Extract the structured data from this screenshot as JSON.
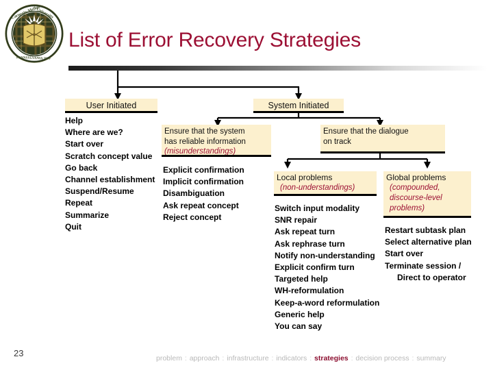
{
  "slide": {
    "title": "List of Error Recovery Strategies",
    "page_number": "23",
    "logo_alt": "carnegie-mellon-university-seal",
    "title_color": "#9C1034",
    "box_fill": "#FCF0CE",
    "accent_color": "#9C1034"
  },
  "diagram": {
    "root_branches": [
      {
        "id": "user-initiated",
        "label": "User Initiated"
      },
      {
        "id": "system-initiated",
        "label": "System Initiated"
      }
    ],
    "user_initiated": {
      "header": "User Initiated",
      "strategies": [
        "Help",
        "Where are we?",
        "Start over",
        "Scratch concept value",
        "Go back",
        "Channel establishment",
        "Suspend/Resume",
        "Repeat",
        "Summarize",
        "Quit"
      ]
    },
    "system_initiated": {
      "header": "System Initiated",
      "goals": [
        {
          "id": "reliable-information",
          "line1": "Ensure that the system",
          "line2": "has reliable information",
          "paren": "(misunderstandings)",
          "strategies": [
            "Explicit confirmation",
            "Implicit confirmation",
            "Disambiguation",
            "Ask repeat concept",
            "Reject concept"
          ]
        },
        {
          "id": "dialogue-on-track",
          "line1": "Ensure that the dialogue",
          "line2": "on track",
          "paren": "",
          "children": [
            {
              "id": "local-problems",
              "title": "Local problems",
              "paren": "(non-understandings)",
              "strategies": [
                "Switch input modality",
                "SNR repair",
                "Ask repeat turn",
                "Ask rephrase turn",
                "Notify non-understanding",
                "Explicit confirm turn",
                "Targeted help",
                "WH-reformulation",
                "Keep-a-word reformulation",
                "Generic help",
                "You can say"
              ]
            },
            {
              "id": "global-problems",
              "title": "Global problems",
              "paren_line1": "(compounded,",
              "paren_line2": "discourse-level",
              "paren_line3": "problems)",
              "strategies": [
                "Restart subtask plan",
                "Select alternative plan",
                "Start over",
                "Terminate session /",
                "Direct to operator"
              ]
            }
          ]
        }
      ]
    }
  },
  "footer": {
    "crumbs": [
      {
        "label": "problem",
        "active": false
      },
      {
        "label": "approach",
        "active": false
      },
      {
        "label": "infrastructure",
        "active": false
      },
      {
        "label": "indicators",
        "active": false
      },
      {
        "label": "strategies",
        "active": true
      },
      {
        "label": "decision process",
        "active": false
      },
      {
        "label": "summary",
        "active": false
      }
    ],
    "separator": ":"
  }
}
